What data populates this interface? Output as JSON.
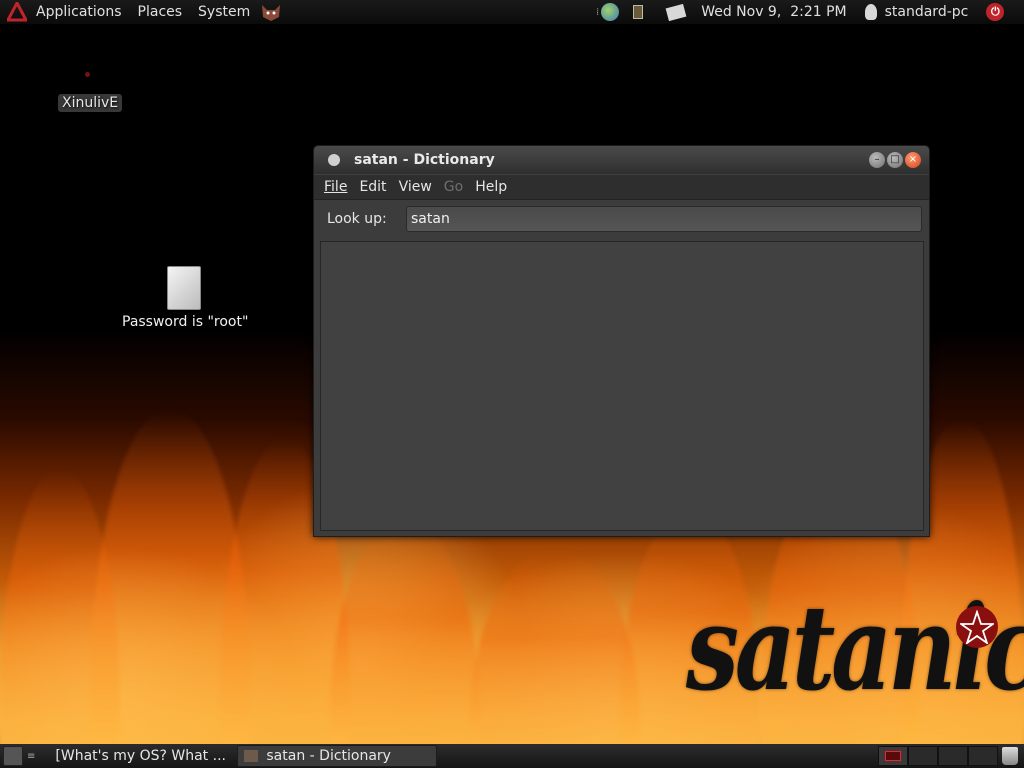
{
  "top_panel": {
    "menus": [
      "Applications",
      "Places",
      "System"
    ],
    "clock": "Wed Nov 9,  2:21 PM",
    "username": "standard-pc"
  },
  "desktop": {
    "icons": [
      {
        "label": "XinulivE"
      },
      {
        "label": "Password is \"root\""
      }
    ],
    "logo_text": "satanic"
  },
  "window": {
    "title": "satan - Dictionary",
    "menu": [
      {
        "label": "File",
        "enabled": true
      },
      {
        "label": "Edit",
        "enabled": true
      },
      {
        "label": "View",
        "enabled": true
      },
      {
        "label": "Go",
        "enabled": false
      },
      {
        "label": "Help",
        "enabled": true
      }
    ],
    "lookup_label": "Look up:",
    "lookup_value": "satan"
  },
  "bottom_panel": {
    "tasks": [
      {
        "label": "[What's my OS? What ..."
      },
      {
        "label": "satan - Dictionary"
      }
    ]
  },
  "colors": {
    "flame_accent": "#f3a73a",
    "close_button": "#d2421b",
    "logo": "#111111"
  }
}
